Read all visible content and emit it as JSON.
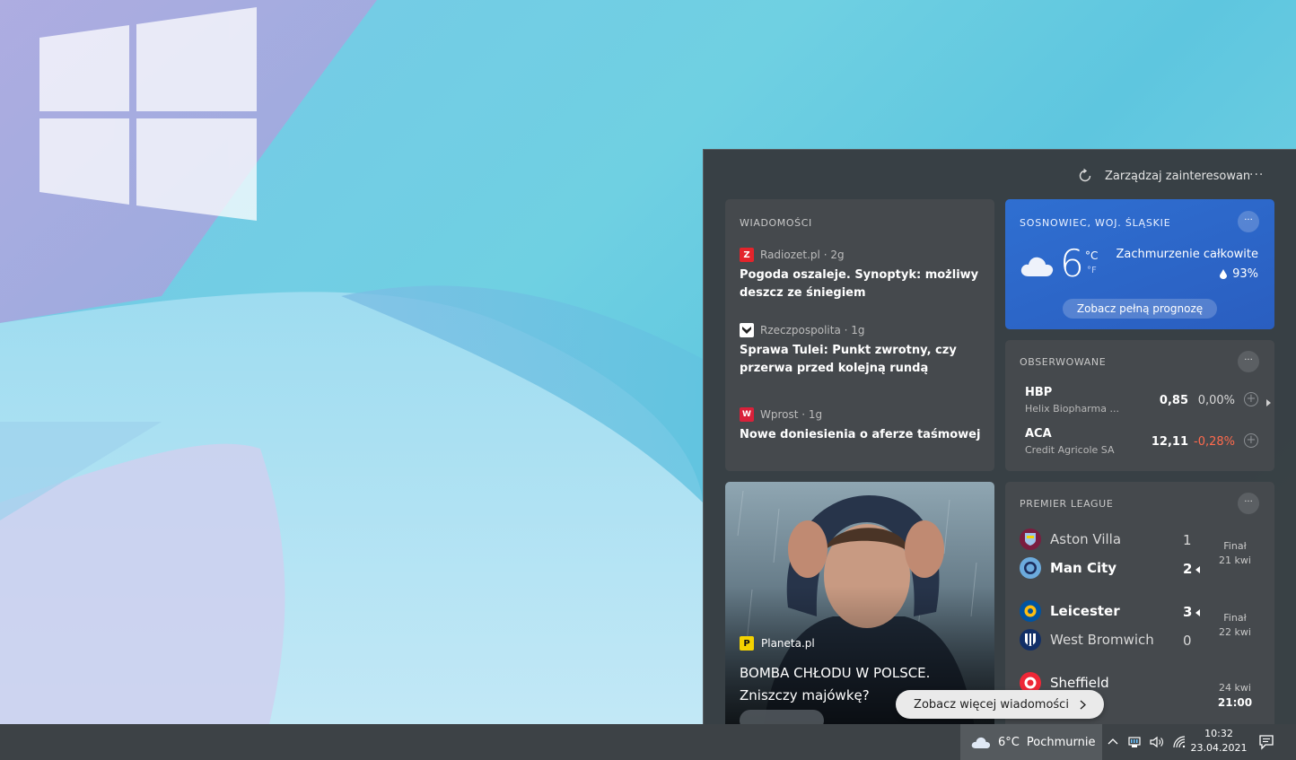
{
  "panel": {
    "manage_label": "Zarządzaj zainteresowan",
    "more_dots": "···"
  },
  "news": {
    "title": "WIADOMOŚCI",
    "items": [
      {
        "source": "Radiozet.pl · 2g",
        "headline": "Pogoda oszaleje. Synoptyk: możliwy deszcz ze śniegiem",
        "logo_color": "#e3242b",
        "logo_glyph": "Z"
      },
      {
        "source": "Rzeczpospolita · 1g",
        "headline": "Sprawa Tulei: Punkt zwrotny, czy przerwa przed kolejną rundą",
        "logo_color": "#ffffff",
        "logo_glyph": ""
      },
      {
        "source": "Wprost · 1g",
        "headline": "Nowe doniesienia o aferze taśmowej",
        "logo_color": "#d9213a",
        "logo_glyph": "W"
      }
    ]
  },
  "weather": {
    "location": "SOSNOWIEC, WOJ. ŚLĄSKIE",
    "temp": "6",
    "unit_c": "°C",
    "unit_f": "°F",
    "condition": "Zachmurzenie całkowite",
    "humidity": "93%",
    "forecast_label": "Zobacz pełną prognozę",
    "more_dots": "···"
  },
  "watchlist": {
    "title": "OBSERWOWANE",
    "more_dots": "···",
    "stocks": [
      {
        "symbol": "HBP",
        "name": "Helix Biopharma ...",
        "price": "0,85",
        "change": "0,00%",
        "change_color": "#d8d8d8"
      },
      {
        "symbol": "ACA",
        "name": "Credit Agricole SA",
        "price": "12,11",
        "change": "-0,28%",
        "change_color": "#ff6a4d"
      }
    ]
  },
  "image_news": {
    "source": "Planeta.pl",
    "headline": "BOMBA CHŁODU W POLSCE. Zniszczy majówkę?"
  },
  "league": {
    "title": "PREMIER LEAGUE",
    "more_dots": "···",
    "matches": [
      {
        "home": "Aston Villa",
        "home_score": "1",
        "away": "Man City",
        "away_score": "2",
        "status": "Finał",
        "date": "21 kwi"
      },
      {
        "home": "Leicester",
        "home_score": "3",
        "away": "West Bromwich",
        "away_score": "0",
        "status": "Finał",
        "date": "22 kwi"
      },
      {
        "home": "Sheffield",
        "date": "24 kwi",
        "time": "21:00"
      }
    ]
  },
  "more_news_label": "Zobacz więcej wiadomości",
  "taskbar": {
    "weather_label": "6°C",
    "weather_condition": "Pochmurnie",
    "time": "10:32",
    "date": "23.04.2021"
  }
}
